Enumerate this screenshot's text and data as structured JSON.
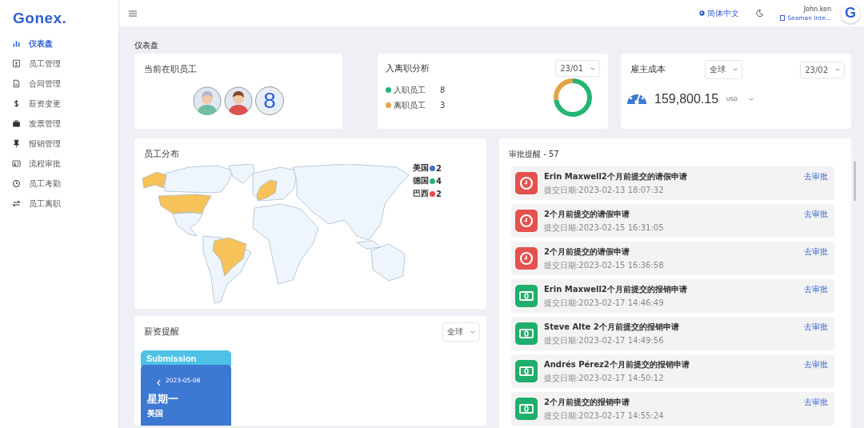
{
  "brand": "Gonex.",
  "sidebar": {
    "items": [
      {
        "label": "仪表盘",
        "selected": true
      },
      {
        "label": "员工管理",
        "selected": false
      },
      {
        "label": "合同管理",
        "selected": false
      },
      {
        "label": "薪资变更",
        "selected": false
      },
      {
        "label": "发票管理",
        "selected": false
      },
      {
        "label": "报销管理",
        "selected": false
      },
      {
        "label": "流程审批",
        "selected": false
      },
      {
        "label": "员工考勤",
        "selected": false
      },
      {
        "label": "员工离职",
        "selected": false
      }
    ]
  },
  "header": {
    "language": "简体中文",
    "user_name": "John.ken",
    "company": "Seaman Inte...",
    "avatar_letter": "G"
  },
  "page_title": "仪表盘",
  "active_employees": {
    "title": "当前在职员工",
    "count": "8"
  },
  "onboarding": {
    "title": "入离职分析",
    "period": "23/01",
    "legend": [
      {
        "label": "入职员工",
        "value": "8",
        "color": "#22b573"
      },
      {
        "label": "离职员工",
        "value": "3",
        "color": "#e3a444"
      }
    ]
  },
  "employer_cost": {
    "title": "雇主成本",
    "region": "全球",
    "period": "23/02",
    "amount": "159,800.15",
    "currency": "USD"
  },
  "distribution": {
    "title": "员工分布",
    "legend": [
      {
        "label": "美国",
        "color": "#3b6fd4",
        "count": "2"
      },
      {
        "label": "德国",
        "color": "#22b573",
        "count": "4"
      },
      {
        "label": "巴西",
        "color": "#e84a4a",
        "count": "2"
      }
    ]
  },
  "salary": {
    "title": "薪资提醒",
    "region": "全球",
    "calendar": {
      "header": "Submission",
      "date": "2023-05-08",
      "weekday": "星期一",
      "country": "美国"
    }
  },
  "approvals": {
    "title": "审批提醒 - 57",
    "items": [
      {
        "kind": "leave",
        "title": "Erin Maxwell2个月前提交的请假申请",
        "date": "提交日期:2023-02-13 18:07:32",
        "action": "去审批"
      },
      {
        "kind": "leave",
        "title": "2个月前提交的请假申请",
        "date": "提交日期:2023-02-15 16:31:05",
        "action": "去审批"
      },
      {
        "kind": "leave",
        "title": "2个月前提交的请假申请",
        "date": "提交日期:2023-02-15 16:36:58",
        "action": "去审批"
      },
      {
        "kind": "expense",
        "title": "Erin Maxwell2个月前提交的报销申请",
        "date": "提交日期:2023-02-17 14:46:49",
        "action": "去审批"
      },
      {
        "kind": "expense",
        "title": "Steve Alte 2个月前提交的报销申请",
        "date": "提交日期:2023-02-17 14:49:56",
        "action": "去审批"
      },
      {
        "kind": "expense",
        "title": "Andrés Pérez2个月前提交的报销申请",
        "date": "提交日期:2023-02-17 14:50:12",
        "action": "去审批"
      },
      {
        "kind": "expense",
        "title": "2个月前提交的报销申请",
        "date": "提交日期:2023-02-17 14:55:24",
        "action": "去审批"
      }
    ]
  }
}
